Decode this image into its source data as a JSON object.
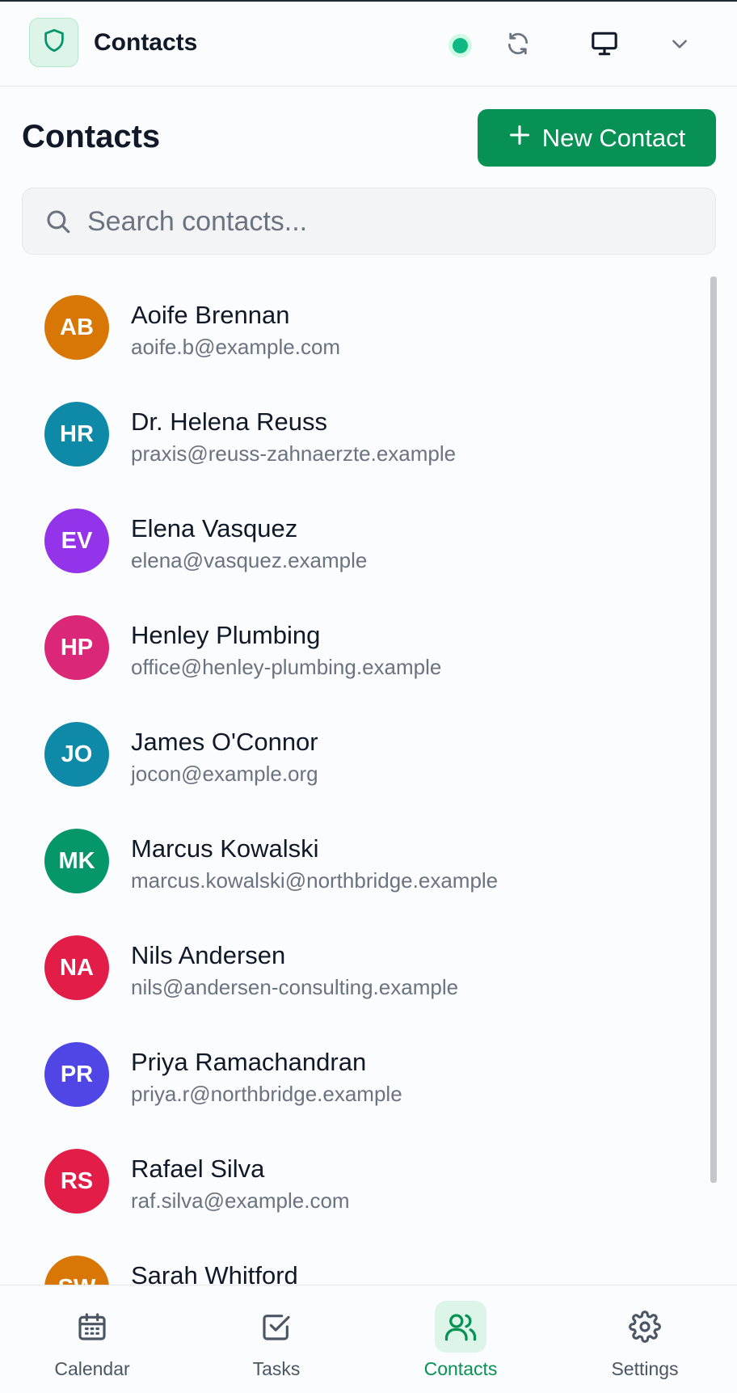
{
  "app": {
    "title": "Contacts"
  },
  "header": {
    "logo_icon": "shield-icon",
    "status_color": "#10b981",
    "icons": [
      "sync-icon",
      "monitor-icon",
      "chevron-down-icon"
    ]
  },
  "page": {
    "title": "Contacts",
    "new_button_label": "New Contact"
  },
  "search": {
    "placeholder": "Search contacts...",
    "value": ""
  },
  "contacts": [
    {
      "initials": "AB",
      "name": "Aoife Brennan",
      "email": "aoife.b@example.com",
      "color": "#d97706"
    },
    {
      "initials": "HR",
      "name": "Dr. Helena Reuss",
      "email": "praxis@reuss-zahnaerzte.example",
      "color": "#0e8aa8"
    },
    {
      "initials": "EV",
      "name": "Elena Vasquez",
      "email": "elena@vasquez.example",
      "color": "#9333ea"
    },
    {
      "initials": "HP",
      "name": "Henley Plumbing",
      "email": "office@henley-plumbing.example",
      "color": "#db2777"
    },
    {
      "initials": "JO",
      "name": "James O'Connor",
      "email": "jocon@example.org",
      "color": "#0e8aa8"
    },
    {
      "initials": "MK",
      "name": "Marcus Kowalski",
      "email": "marcus.kowalski@northbridge.example",
      "color": "#059669"
    },
    {
      "initials": "NA",
      "name": "Nils Andersen",
      "email": "nils@andersen-consulting.example",
      "color": "#e11d48"
    },
    {
      "initials": "PR",
      "name": "Priya Ramachandran",
      "email": "priya.r@northbridge.example",
      "color": "#4f46e5"
    },
    {
      "initials": "RS",
      "name": "Rafael Silva",
      "email": "raf.silva@example.com",
      "color": "#e11d48"
    },
    {
      "initials": "SW",
      "name": "Sarah Whitford",
      "email": "",
      "color": "#d97706"
    }
  ],
  "nav": [
    {
      "label": "Calendar",
      "icon": "calendar-icon",
      "active": false
    },
    {
      "label": "Tasks",
      "icon": "tasks-icon",
      "active": false
    },
    {
      "label": "Contacts",
      "icon": "contacts-icon",
      "active": true
    },
    {
      "label": "Settings",
      "icon": "gear-icon",
      "active": false
    }
  ]
}
